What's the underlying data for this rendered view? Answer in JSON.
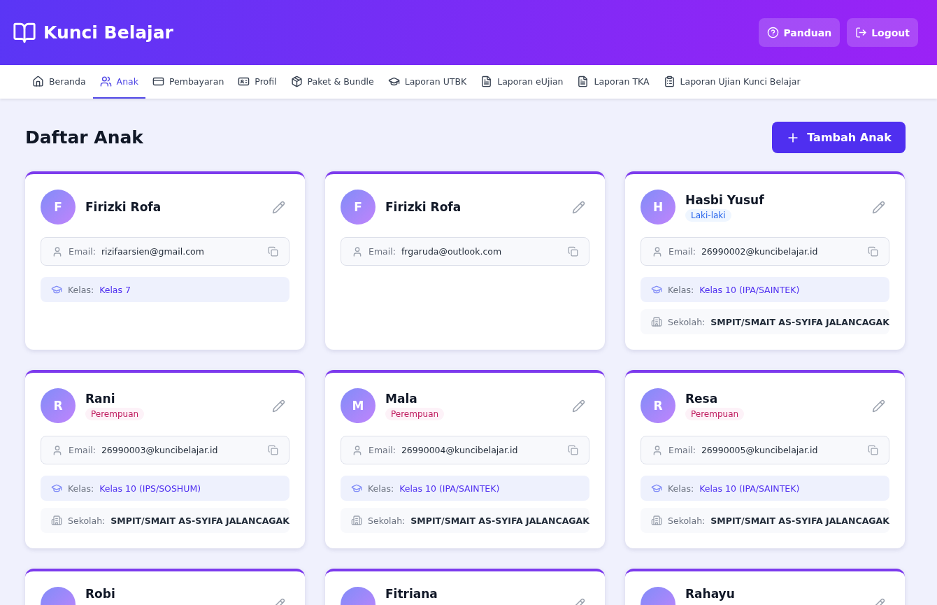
{
  "header": {
    "brand": "Kunci Belajar",
    "buttons": [
      "Panduan",
      "Logout"
    ]
  },
  "nav": [
    {
      "label": "Beranda",
      "selected": false
    },
    {
      "label": "Anak",
      "selected": true
    },
    {
      "label": "Pembayaran",
      "selected": false
    },
    {
      "label": "Profil",
      "selected": false
    },
    {
      "label": "Paket & Bundle",
      "selected": false
    },
    {
      "label": "Laporan UTBK",
      "selected": false
    },
    {
      "label": "Laporan eUjian",
      "selected": false
    },
    {
      "label": "Laporan TKA",
      "selected": false
    },
    {
      "label": "Laporan Ujian Kunci Belajar",
      "selected": false
    }
  ],
  "page": {
    "title": "Daftar Anak",
    "add_button": "Tambah Anak"
  },
  "children": [
    {
      "initial": "F",
      "name": "Firizki Rofa",
      "email_label": "Email:",
      "email": "rizifaarsien@gmail.com",
      "class_label": "Kelas:",
      "class": "Kelas 7"
    },
    {
      "initial": "F",
      "name": "Firizki Rofa",
      "email_label": "Email:",
      "email": "frgaruda@outlook.com"
    },
    {
      "initial": "H",
      "name": "Hasbi Yusuf",
      "gender": {
        "kind": "male",
        "label": "Laki-laki"
      },
      "email_label": "Email:",
      "email": "26990002@kuncibelajar.id",
      "class_label": "Kelas:",
      "class": "Kelas 10 (IPA/SAINTEK)",
      "school_label": "Sekolah:",
      "school": "SMPIT/SMAIT AS-SYIFA JALANCAGAK"
    },
    {
      "initial": "R",
      "name": "Rani",
      "gender": {
        "kind": "female",
        "label": "Perempuan"
      },
      "email_label": "Email:",
      "email": "26990003@kuncibelajar.id",
      "class_label": "Kelas:",
      "class": "Kelas 10 (IPS/SOSHUM)",
      "school_label": "Sekolah:",
      "school": "SMPIT/SMAIT AS-SYIFA JALANCAGAK"
    },
    {
      "initial": "M",
      "name": "Mala",
      "gender": {
        "kind": "female",
        "label": "Perempuan"
      },
      "email_label": "Email:",
      "email": "26990004@kuncibelajar.id",
      "class_label": "Kelas:",
      "class": "Kelas 10 (IPA/SAINTEK)",
      "school_label": "Sekolah:",
      "school": "SMPIT/SMAIT AS-SYIFA JALANCAGAK"
    },
    {
      "initial": "R",
      "name": "Resa",
      "gender": {
        "kind": "female",
        "label": "Perempuan"
      },
      "email_label": "Email:",
      "email": "26990005@kuncibelajar.id",
      "class_label": "Kelas:",
      "class": "Kelas 10 (IPA/SAINTEK)",
      "school_label": "Sekolah:",
      "school": "SMPIT/SMAIT AS-SYIFA JALANCAGAK"
    },
    {
      "name": "Robi"
    },
    {
      "name": "Fitriana"
    },
    {
      "name": "Rahayu"
    }
  ]
}
